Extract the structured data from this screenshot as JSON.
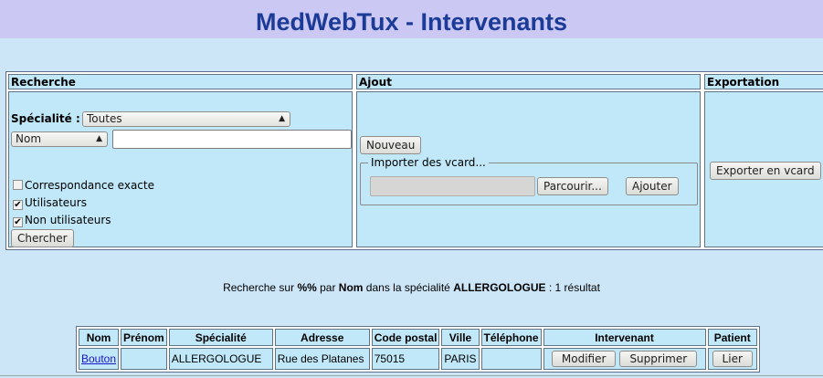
{
  "header": {
    "title": "MedWebTux - Intervenants"
  },
  "search": {
    "heading": "Recherche",
    "specialty_label": "Spécialité :",
    "specialty_value": "Toutes",
    "field_value": "Nom",
    "query_value": "",
    "exact_label": "Correspondance exacte",
    "exact_checked": false,
    "users_label": "Utilisateurs",
    "users_checked": true,
    "nonusers_label": "Non utilisateurs",
    "nonusers_checked": true,
    "search_button": "Chercher"
  },
  "add": {
    "heading": "Ajout",
    "new_button": "Nouveau",
    "import_legend": "Importer des vcard...",
    "browse_button": "Parcourir...",
    "add_button": "Ajouter"
  },
  "export": {
    "heading": "Exportation",
    "export_button": "Exporter en vcard"
  },
  "status": {
    "prefix": "Recherche sur ",
    "pattern": "%%",
    "by": " par ",
    "field": "Nom",
    "middle": " dans la spécialité ",
    "specialty": "ALLERGOLOGUE",
    "suffix": " : 1 résultat"
  },
  "results": {
    "columns": [
      "Nom",
      "Prénom",
      "Spécialité",
      "Adresse",
      "Code postal",
      "Ville",
      "Téléphone",
      "Intervenant",
      "Patient"
    ],
    "rows": [
      {
        "nom": "Bouton",
        "prenom": "",
        "specialite": "ALLERGOLOGUE",
        "adresse": "Rue des Platanes",
        "code_postal": "75015",
        "ville": "PARIS",
        "telephone": "",
        "modify_button": "Modifier",
        "delete_button": "Supprimer",
        "link_button": "Lier"
      }
    ]
  }
}
